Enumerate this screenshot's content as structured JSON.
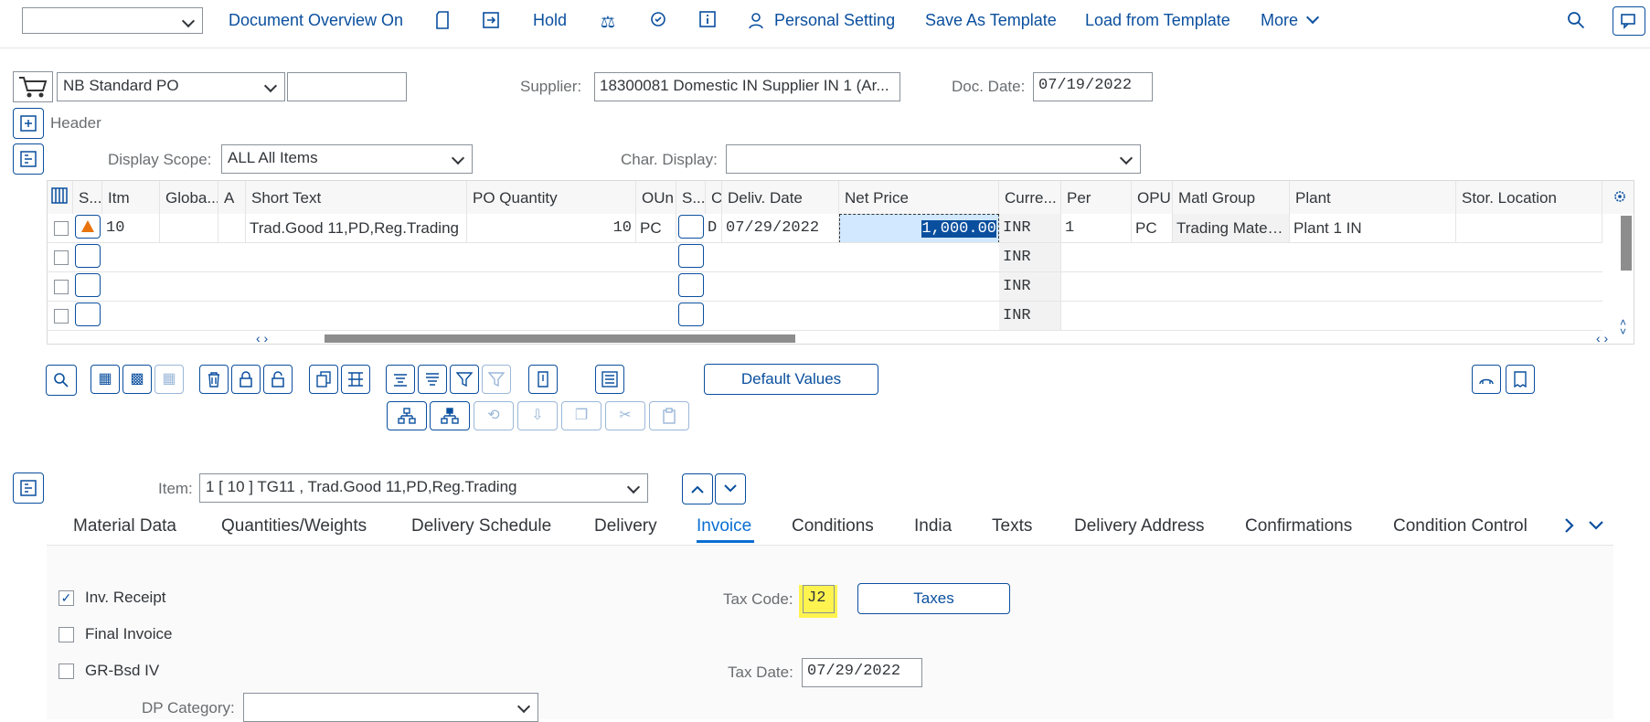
{
  "toolbar": {
    "doc_overview": "Document Overview On",
    "hold": "Hold",
    "personal_setting": "Personal Setting",
    "save_template": "Save As Template",
    "load_template": "Load from Template",
    "more": "More"
  },
  "header": {
    "order_type": "NB Standard PO",
    "supplier_label": "Supplier:",
    "supplier_value": "18300081 Domestic IN Supplier IN 1 (Ar...",
    "doc_date_label": "Doc. Date:",
    "doc_date_value": "07/19/2022",
    "header_label": "Header",
    "display_scope_label": "Display Scope:",
    "display_scope_value": "ALL All Items",
    "char_display_label": "Char. Display:"
  },
  "table": {
    "columns": [
      "S...",
      "Itm",
      "Globa...",
      "A",
      "Short Text",
      "PO Quantity",
      "OUn",
      "S...",
      "C",
      "Deliv. Date",
      "Net Price",
      "Curre...",
      "Per",
      "OPU",
      "Matl Group",
      "Plant",
      "Stor. Location"
    ],
    "row1": {
      "itm": "10",
      "short_text": "Trad.Good 11,PD,Reg.Trading",
      "po_qty": "10",
      "oun": "PC",
      "c": "D",
      "deliv_date": "07/29/2022",
      "net_price": "1,000.00",
      "currency": "INR",
      "per": "1",
      "opu": "PC",
      "matl_group": "Trading Materi...",
      "plant": "Plant 1 IN"
    },
    "empty_currency": "INR",
    "scroll_arrows": "‹ ›"
  },
  "buttons": {
    "default_values": "Default Values",
    "taxes": "Taxes"
  },
  "item": {
    "label": "Item:",
    "value": "1 [ 10 ] TG11 , Trad.Good 11,PD,Reg.Trading"
  },
  "tabs": [
    "Material Data",
    "Quantities/Weights",
    "Delivery Schedule",
    "Delivery",
    "Invoice",
    "Conditions",
    "India",
    "Texts",
    "Delivery Address",
    "Confirmations",
    "Condition Control"
  ],
  "invoice": {
    "inv_receipt": "Inv. Receipt",
    "final_invoice": "Final Invoice",
    "gr_bsd_iv": "GR-Bsd IV",
    "dp_category": "DP Category:",
    "tax_code_label": "Tax Code:",
    "tax_code_value": "J2",
    "tax_date_label": "Tax Date:",
    "tax_date_value": "07/29/2022"
  },
  "colors": {
    "accent": "#0a4f9e",
    "active_tab": "#0a6ed1",
    "highlight": "#fff44f",
    "warning": "#e9730c"
  }
}
